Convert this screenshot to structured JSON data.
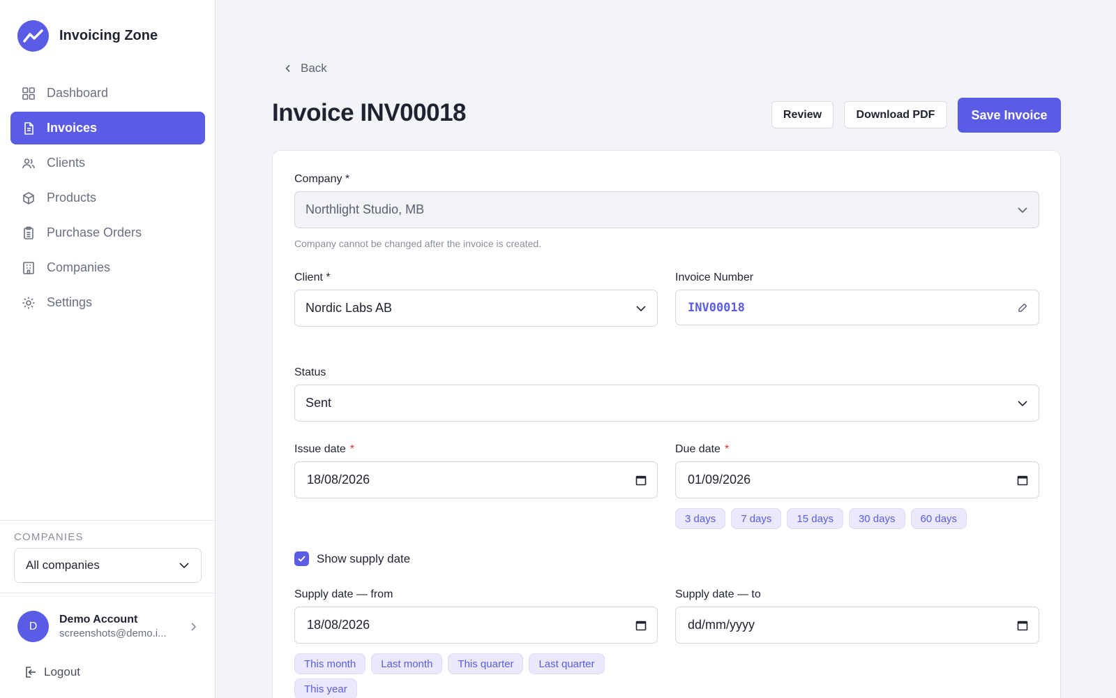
{
  "app": {
    "name": "Invoicing Zone"
  },
  "sidebar": {
    "items": [
      {
        "label": "Dashboard",
        "icon": "grid-icon",
        "active": false
      },
      {
        "label": "Invoices",
        "icon": "document-icon",
        "active": true
      },
      {
        "label": "Clients",
        "icon": "users-icon",
        "active": false
      },
      {
        "label": "Products",
        "icon": "box-icon",
        "active": false
      },
      {
        "label": "Purchase Orders",
        "icon": "clipboard-icon",
        "active": false
      },
      {
        "label": "Companies",
        "icon": "building-icon",
        "active": false
      },
      {
        "label": "Settings",
        "icon": "gear-icon",
        "active": false
      }
    ],
    "companies_title": "COMPANIES",
    "companies_select": "All companies",
    "user": {
      "initial": "D",
      "name": "Demo Account",
      "email": "screenshots@demo.i..."
    },
    "logout": "Logout"
  },
  "header": {
    "back": "Back",
    "title": "Invoice INV00018",
    "review": "Review",
    "download_pdf": "Download PDF",
    "save": "Save Invoice"
  },
  "form": {
    "company_label": "Company *",
    "company_value": "Northlight Studio, MB",
    "company_hint": "Company cannot be changed after the invoice is created.",
    "client_label": "Client *",
    "client_value": "Nordic Labs AB",
    "invoice_number_label": "Invoice Number",
    "invoice_number_value": "INV00018",
    "status_label": "Status",
    "status_value": "Sent",
    "issue_date_label": "Issue date",
    "issue_date_value": "18/08/2026",
    "due_date_label": "Due date",
    "due_date_value": "01/09/2026",
    "required_mark": "*",
    "due_chips": [
      "3 days",
      "7 days",
      "15 days",
      "30 days",
      "60 days"
    ],
    "show_supply_label": "Show supply date",
    "show_supply_checked": true,
    "supply_from_label": "Supply date — from",
    "supply_from_value": "18/08/2026",
    "supply_to_label": "Supply date — to",
    "supply_to_placeholder": "dd/mm/yyyy",
    "supply_chips": [
      "This month",
      "Last month",
      "This quarter",
      "Last quarter",
      "This year"
    ]
  },
  "colors": {
    "accent": "#5a5ce6",
    "required": "#d92d3a"
  }
}
